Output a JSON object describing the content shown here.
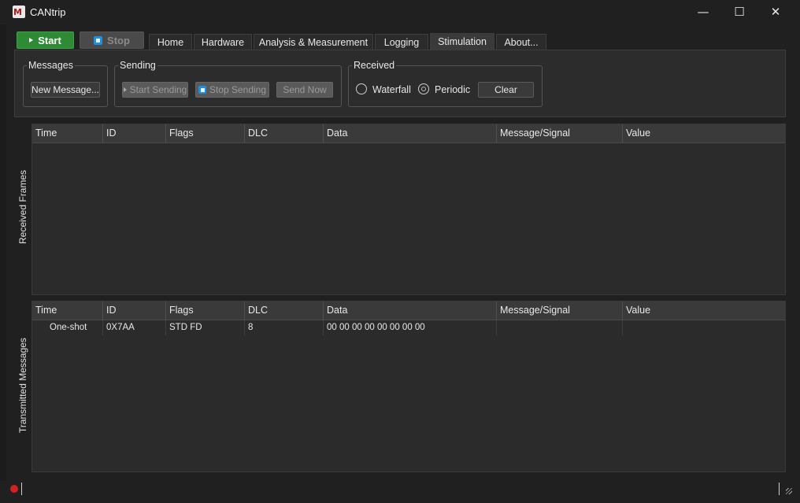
{
  "window": {
    "title": "CANtrip",
    "minimize_glyph": "—",
    "maximize_glyph": "☐",
    "close_glyph": "✕"
  },
  "toolbar": {
    "start_label": "Start",
    "stop_label": "Stop"
  },
  "tabs": [
    {
      "label": "Home"
    },
    {
      "label": "Hardware"
    },
    {
      "label": "Analysis & Measurement"
    },
    {
      "label": "Logging"
    },
    {
      "label": "Stimulation",
      "active": true
    },
    {
      "label": "About..."
    }
  ],
  "panel": {
    "messages": {
      "title": "Messages",
      "new_message_label": "New Message..."
    },
    "sending": {
      "title": "Sending",
      "start_sending_label": "Start Sending",
      "stop_sending_label": "Stop Sending",
      "send_now_label": "Send Now"
    },
    "received": {
      "title": "Received",
      "waterfall_label": "Waterfall",
      "periodic_label": "Periodic",
      "clear_label": "Clear",
      "selected": "Periodic"
    }
  },
  "received_frames": {
    "side_label": "Received Frames",
    "columns": [
      "Time",
      "ID",
      "Flags",
      "DLC",
      "Data",
      "Message/Signal",
      "Value"
    ],
    "rows": []
  },
  "transmitted_messages": {
    "side_label": "Transmitted Messages",
    "columns": [
      "Time",
      "ID",
      "Flags",
      "DLC",
      "Data",
      "Message/Signal",
      "Value"
    ],
    "rows": [
      {
        "time": "One-shot",
        "id": "0X7AA",
        "flags": "STD FD",
        "dlc": "8",
        "data": "00 00 00 00 00 00 00 00",
        "message_signal": "",
        "value": ""
      }
    ]
  },
  "colors": {
    "start_green": "#2f8a35",
    "status_red": "#d42020",
    "stop_blue": "#1f8fe0"
  }
}
